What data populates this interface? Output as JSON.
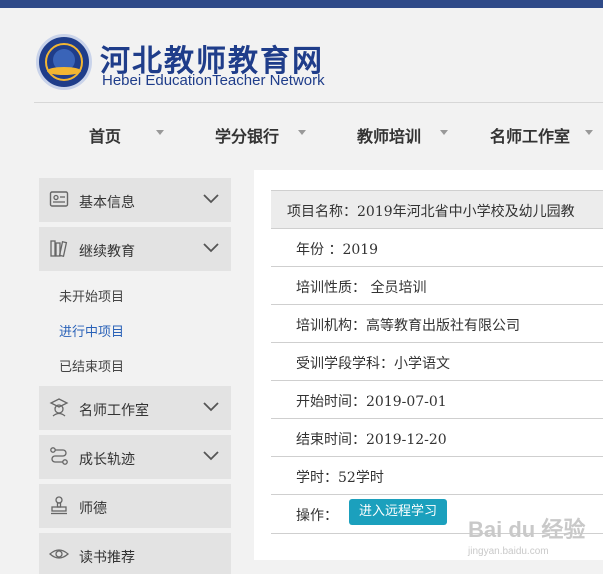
{
  "site": {
    "title": "河北教师教育网",
    "subtitle": "Hebei EducationTeacher  Network"
  },
  "nav": [
    "首页",
    "学分银行",
    "教师培训",
    "名师工作室"
  ],
  "sidebar": {
    "basic_info": "基本信息",
    "continuing_edu": "继续教育",
    "sub_items": [
      "未开始项目",
      "进行中项目",
      "已结束项目"
    ],
    "master_studio": "名师工作室",
    "growth": "成长轨迹",
    "ethics": "师德",
    "reading": "读书推荐"
  },
  "project": {
    "name": "项目名称：2019年河北省中小学校及幼儿园教",
    "year": "年份 ：2019",
    "nature": "培训性质：  全员培训",
    "org": "培训机构：高等教育出版社有限公司",
    "subject": "受训学段学科：小学语文",
    "start": "开始时间：2019-07-01",
    "end": "结束时间：2019-12-20",
    "hours": "学时：52学时",
    "op_label": "操作：",
    "op_button": "进入远程学习"
  },
  "watermark": {
    "brand": "Bai du 经验",
    "url": "jingyan.baidu.com"
  }
}
